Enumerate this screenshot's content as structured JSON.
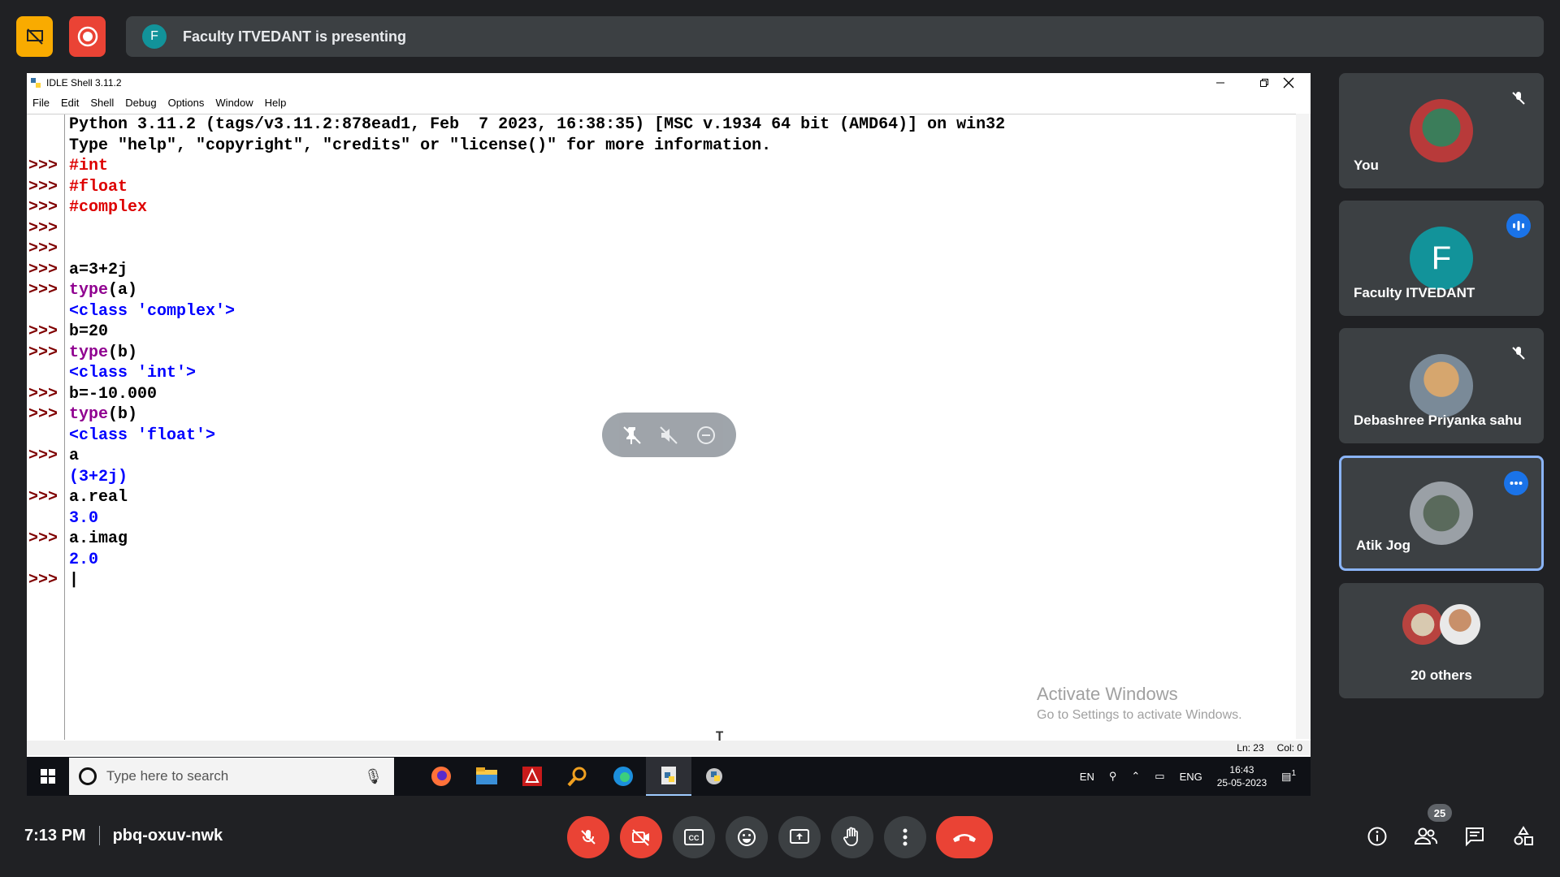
{
  "presentation": {
    "banner_text": "Faculty ITVEDANT is presenting",
    "presenter_initial": "F"
  },
  "idle_window": {
    "title": "IDLE Shell 3.11.2",
    "menu": [
      "File",
      "Edit",
      "Shell",
      "Debug",
      "Options",
      "Window",
      "Help"
    ],
    "prompt": ">>>",
    "lines": [
      {
        "prompt": false,
        "segments": [
          {
            "text": "Python 3.11.2 (tags/v3.11.2:878ead1, Feb  7 2023, 16:38:35) [MSC v.1934 64 bit (AMD64)] on win32",
            "color": "#000000"
          }
        ]
      },
      {
        "prompt": false,
        "segments": [
          {
            "text": "Type \"help\", \"copyright\", \"credits\" or \"license()\" for more information.",
            "color": "#000000"
          }
        ]
      },
      {
        "prompt": true,
        "segments": [
          {
            "text": "#int",
            "color": "#dd0000"
          }
        ]
      },
      {
        "prompt": true,
        "segments": [
          {
            "text": "#float",
            "color": "#dd0000"
          }
        ]
      },
      {
        "prompt": true,
        "segments": [
          {
            "text": "#complex",
            "color": "#dd0000"
          }
        ]
      },
      {
        "prompt": true,
        "segments": []
      },
      {
        "prompt": true,
        "segments": []
      },
      {
        "prompt": true,
        "segments": [
          {
            "text": "a=3+2j",
            "color": "#000000"
          }
        ]
      },
      {
        "prompt": true,
        "segments": [
          {
            "text": "type",
            "color": "#900090"
          },
          {
            "text": "(a)",
            "color": "#000000"
          }
        ]
      },
      {
        "prompt": false,
        "segments": [
          {
            "text": "<class 'complex'>",
            "color": "#0000ff"
          }
        ]
      },
      {
        "prompt": true,
        "segments": [
          {
            "text": "b=20",
            "color": "#000000"
          }
        ]
      },
      {
        "prompt": true,
        "segments": [
          {
            "text": "type",
            "color": "#900090"
          },
          {
            "text": "(b)",
            "color": "#000000"
          }
        ]
      },
      {
        "prompt": false,
        "segments": [
          {
            "text": "<class 'int'>",
            "color": "#0000ff"
          }
        ]
      },
      {
        "prompt": true,
        "segments": [
          {
            "text": "b=-10.000",
            "color": "#000000"
          }
        ]
      },
      {
        "prompt": true,
        "segments": [
          {
            "text": "type",
            "color": "#900090"
          },
          {
            "text": "(b)",
            "color": "#000000"
          }
        ]
      },
      {
        "prompt": false,
        "segments": [
          {
            "text": "<class 'float'>",
            "color": "#0000ff"
          }
        ]
      },
      {
        "prompt": true,
        "segments": [
          {
            "text": "a",
            "color": "#000000"
          }
        ]
      },
      {
        "prompt": false,
        "segments": [
          {
            "text": "(3+2j)",
            "color": "#0000ff"
          }
        ]
      },
      {
        "prompt": true,
        "segments": [
          {
            "text": "a.real",
            "color": "#000000"
          }
        ]
      },
      {
        "prompt": false,
        "segments": [
          {
            "text": "3.0",
            "color": "#0000ff"
          }
        ]
      },
      {
        "prompt": true,
        "segments": [
          {
            "text": "a.imag",
            "color": "#000000"
          }
        ]
      },
      {
        "prompt": false,
        "segments": [
          {
            "text": "2.0",
            "color": "#0000ff"
          }
        ]
      },
      {
        "prompt": true,
        "segments": [
          {
            "text": "|",
            "color": "#000000"
          }
        ]
      }
    ],
    "status_line": "Ln: 23",
    "status_col": "Col: 0",
    "watermark_title": "Activate Windows",
    "watermark_sub": "Go to Settings to activate Windows."
  },
  "taskbar": {
    "search_placeholder": "Type here to search",
    "lang_en": "EN",
    "lang_eng": "ENG",
    "time": "16:43",
    "date": "25-05-2023",
    "notification_count": "1"
  },
  "participants": [
    {
      "name": "You",
      "status": "muted"
    },
    {
      "name": "Faculty ITVEDANT",
      "initial": "F",
      "status": "speaking"
    },
    {
      "name": "Debashree Priyanka sahu",
      "status": "muted"
    },
    {
      "name": "Atik Jog",
      "status": "more"
    },
    {
      "name": "20 others"
    }
  ],
  "meeting": {
    "time": "7:13 PM",
    "code": "pbq-oxuv-nwk",
    "participant_count": "25"
  },
  "colors": {
    "accent": "#8ab4f8",
    "danger": "#ea4335",
    "warning": "#f9ab00",
    "tile_bg": "#3c4043"
  }
}
